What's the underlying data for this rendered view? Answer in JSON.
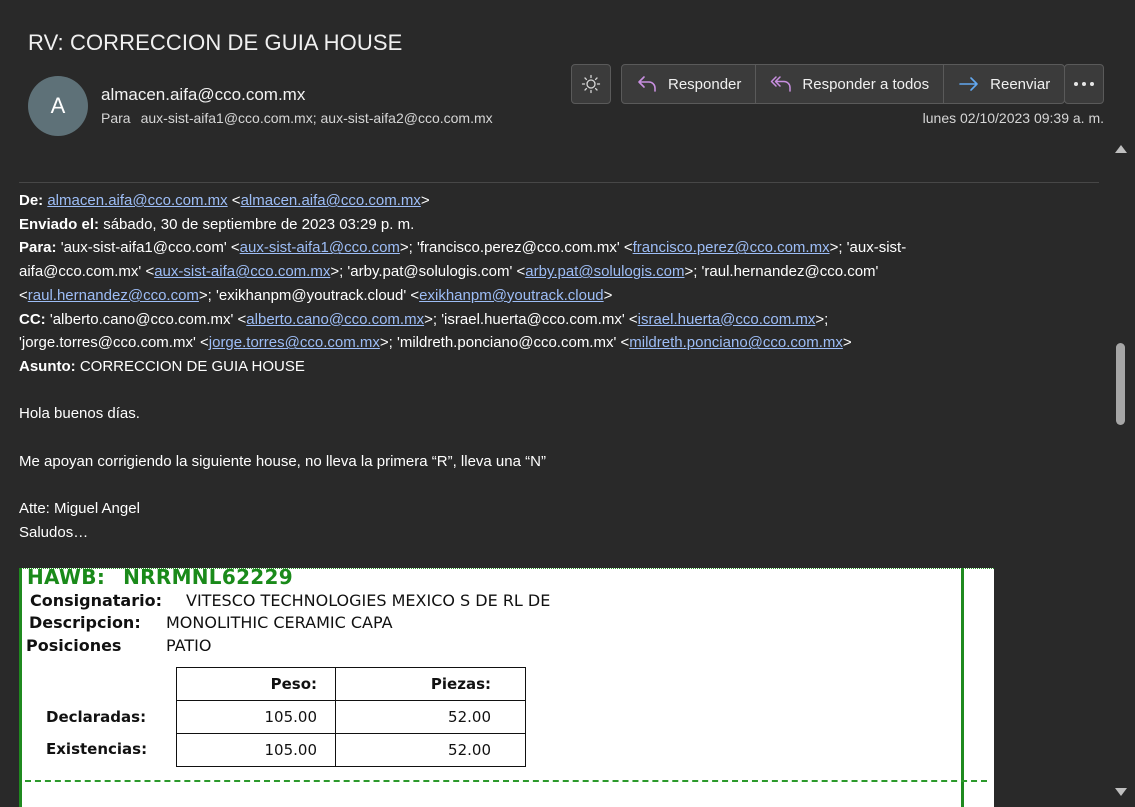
{
  "subject": "RV: CORRECCION DE GUIA HOUSE",
  "avatar_initial": "A",
  "sender": "almacen.aifa@cco.com.mx",
  "to_label": "Para",
  "to_value": "aux-sist-aifa1@cco.com.mx; aux-sist-aifa2@cco.com.mx",
  "date": "lunes 02/10/2023 09:39 a. m.",
  "toolbar": {
    "theme_icon": "sun-icon",
    "reply": "Responder",
    "reply_all": "Responder a todos",
    "forward": "Reenviar",
    "more_icon": "ellipsis-icon"
  },
  "colors": {
    "accent_reply": "#c88fe0",
    "accent_forward": "#62a8f0",
    "link": "#9dbdf6",
    "green": "#1a8a1a"
  },
  "header": {
    "de_label": "De:",
    "de_link1": "almacen.aifa@cco.com.mx",
    "de_lt": " <",
    "de_link2": "almacen.aifa@cco.com.mx",
    "de_gt": ">",
    "enviado_label": "Enviado el:",
    "enviado_value": " sábado, 30 de septiembre de 2023 03:29 p. m.",
    "para_label": "Para:",
    "para_t1": " 'aux-sist-aifa1@cco.com' <",
    "para_l1": "aux-sist-aifa1@cco.com",
    "para_t2": ">; 'francisco.perez@cco.com.mx' <",
    "para_l2": "francisco.perez@cco.com.mx",
    "para_t3": ">; 'aux-sist-",
    "para_t4": "aifa@cco.com.mx' <",
    "para_l3": "aux-sist-aifa@cco.com.mx",
    "para_t5": ">; 'arby.pat@solulogis.com' <",
    "para_l4": "arby.pat@solulogis.com",
    "para_t6": ">; 'raul.hernandez@cco.com'",
    "para_t7": "<",
    "para_l5": "raul.hernandez@cco.com",
    "para_t8": ">; 'exikhanpm@youtrack.cloud' <",
    "para_l6": "exikhanpm@youtrack.cloud",
    "para_t9": ">",
    "cc_label": "CC:",
    "cc_t1": " 'alberto.cano@cco.com.mx' <",
    "cc_l1": "alberto.cano@cco.com.mx",
    "cc_t2": ">; 'israel.huerta@cco.com.mx' <",
    "cc_l2": "israel.huerta@cco.com.mx",
    "cc_t3": ">;",
    "cc_t4": "'jorge.torres@cco.com.mx' <",
    "cc_l3": "jorge.torres@cco.com.mx",
    "cc_t5": ">; 'mildreth.ponciano@cco.com.mx' <",
    "cc_l4": "mildreth.ponciano@cco.com.mx",
    "cc_t6": ">",
    "asunto_label": "Asunto:",
    "asunto_value": " CORRECCION DE GUIA HOUSE"
  },
  "message": {
    "greeting": "Hola buenos días.",
    "request": "Me apoyan corrigiendo la siguiente house, no lleva la primera “R”, lleva una “N”",
    "sign1": "Atte: Miguel Angel",
    "sign2": "Saludos…"
  },
  "document": {
    "hawb_label": "HAWB:",
    "hawb_number": "NRRMNL62229",
    "consignatario_label": "Consignatario:",
    "consignatario_value": "VITESCO TECHNOLOGIES MEXICO S DE RL DE",
    "descripcion_label": "Descripcion:",
    "descripcion_value": "MONOLITHIC CERAMIC CAPA",
    "posiciones_label": "Posiciones",
    "posiciones_value": "PATIO",
    "table": {
      "headers": [
        "Peso:",
        "Piezas:"
      ],
      "rows": [
        {
          "label": "Declaradas:",
          "peso": "105.00",
          "piezas": "52.00"
        },
        {
          "label": "Existencias:",
          "peso": "105.00",
          "piezas": "52.00"
        }
      ]
    }
  }
}
